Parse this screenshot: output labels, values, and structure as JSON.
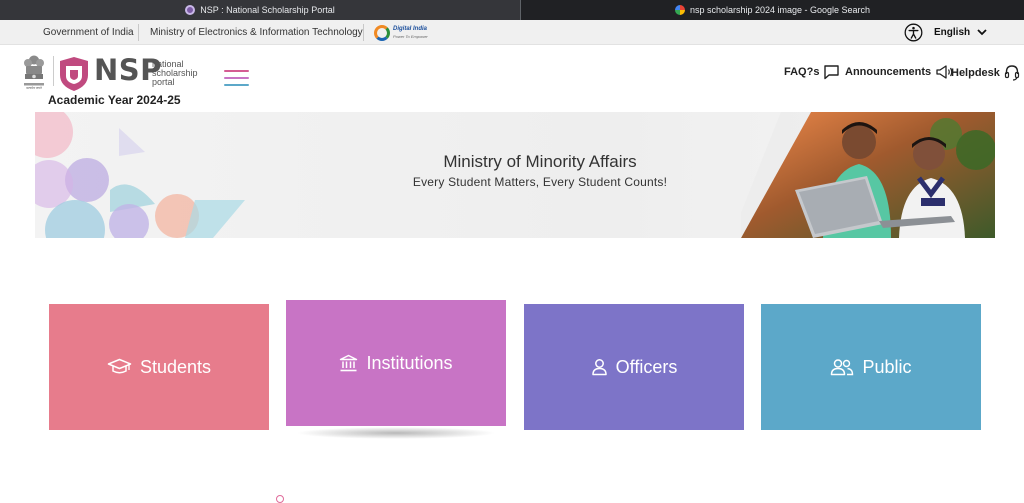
{
  "browser": {
    "tabs": [
      {
        "title": "NSP : National Scholarship Portal",
        "active": true,
        "icon": "nsp-favicon"
      },
      {
        "title": "nsp scholarship 2024 image - Google Search",
        "active": false,
        "icon": "google-favicon"
      }
    ]
  },
  "gov_bar": {
    "government": "Government of India",
    "ministry": "Ministry of Electronics & Information Technology",
    "digital_india_line1": "Digital India",
    "digital_india_line2": "Power To Empower",
    "language": "English"
  },
  "header": {
    "logo_word": "NSP",
    "logo_sub": [
      "national",
      "scholarship",
      "portal"
    ],
    "emblem_caption": "सत्यमेव जयते",
    "academic_year": "Academic Year 2024-25",
    "nav": [
      {
        "label": "FAQ?s",
        "icon": "chat-icon"
      },
      {
        "label": "Announcements",
        "icon": "megaphone-icon"
      },
      {
        "label": "Helpdesk",
        "icon": "headset-icon"
      }
    ]
  },
  "banner": {
    "title": "Ministry of Minority Affairs",
    "subtitle": "Every Student Matters, Every Student Counts!"
  },
  "cards": [
    {
      "label": "Students",
      "icon": "graduation-cap-icon",
      "color": "#e77c8c"
    },
    {
      "label": "Institutions",
      "icon": "institution-icon",
      "color": "#c874c5"
    },
    {
      "label": "Officers",
      "icon": "user-icon",
      "color": "#7d74c8"
    },
    {
      "label": "Public",
      "icon": "users-icon",
      "color": "#5ca8c9"
    }
  ],
  "colors": {
    "hamburger": [
      "#d45c93",
      "#c874c5",
      "#5ca8c9"
    ],
    "shield": "#c04a7f"
  }
}
